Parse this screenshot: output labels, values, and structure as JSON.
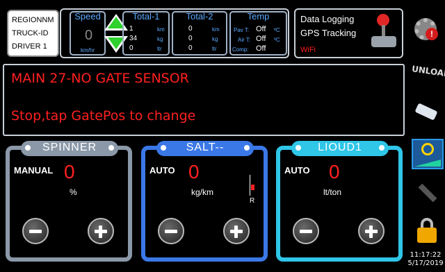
{
  "vehicle": {
    "region": "REGIONNM",
    "truck_id": "TRUCK-ID",
    "driver": "DRIVER 1"
  },
  "speed": {
    "label": "Speed",
    "value": "0",
    "unit": "km/hr"
  },
  "total1": {
    "label": "Total-1",
    "rows": [
      {
        "value": "1",
        "unit": "km"
      },
      {
        "value": "34",
        "unit": "kg"
      },
      {
        "value": "0",
        "unit": "ltr"
      }
    ]
  },
  "total2": {
    "label": "Total-2",
    "rows": [
      {
        "value": "0",
        "unit": "km"
      },
      {
        "value": "0",
        "unit": "kg"
      },
      {
        "value": "0",
        "unit": "ltr"
      }
    ]
  },
  "temp": {
    "label": "Temp",
    "rows": [
      {
        "label": "Pav T:",
        "value": "Off",
        "unit": "ºC"
      },
      {
        "label": "Air T:",
        "value": "Off",
        "unit": "ºC"
      },
      {
        "label": "Comp:",
        "value": "Off",
        "unit": ""
      }
    ]
  },
  "status": {
    "data_logging": "Data Logging",
    "gps_tracking": "GPS Tracking",
    "wifi": "WiFi"
  },
  "message": {
    "line1": "MAIN 27-NO GATE SENSOR",
    "line2": "Stop,tap GatePos to change"
  },
  "panels": [
    {
      "title": "SPINNER",
      "mode": "MANUAL",
      "value": "0",
      "unit": "%"
    },
    {
      "title": "SALT--",
      "mode": "AUTO",
      "value": "0",
      "unit": "kg/km",
      "gauge_label": "R"
    },
    {
      "title": "LIOUD1",
      "mode": "AUTO",
      "value": "0",
      "unit": "lt/ton"
    }
  ],
  "sidebar": {
    "unload_label": "UNLOAD"
  },
  "clock": {
    "time": "11:17:22",
    "date": "5/17/2019"
  },
  "colors": {
    "alarm_red": "#ff2020",
    "accent_blue": "#5aa9ff",
    "spinner_border": "#8a98a8",
    "salt_border": "#3b78e7",
    "liquid_border": "#2fc6e8"
  }
}
